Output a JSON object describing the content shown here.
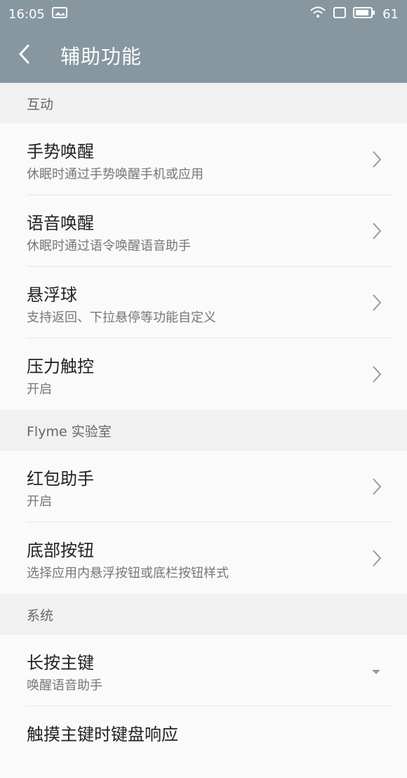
{
  "status": {
    "time": "16:05",
    "battery": "61"
  },
  "appbar": {
    "title": "辅助功能"
  },
  "sections": [
    {
      "header": "互动",
      "items": [
        {
          "title": "手势唤醒",
          "subtitle": "休眠时通过手势唤醒手机或应用"
        },
        {
          "title": "语音唤醒",
          "subtitle": "休眠时通过语令唤醒语音助手"
        },
        {
          "title": "悬浮球",
          "subtitle": "支持返回、下拉悬停等功能自定义"
        },
        {
          "title": "压力触控",
          "subtitle": "开启"
        }
      ]
    },
    {
      "header": "Flyme 实验室",
      "items": [
        {
          "title": "红包助手",
          "subtitle": "开启"
        },
        {
          "title": "底部按钮",
          "subtitle": "选择应用内悬浮按钮或底栏按钮样式"
        }
      ]
    },
    {
      "header": "系统",
      "items": [
        {
          "title": "长按主键",
          "subtitle": "唤醒语音助手"
        },
        {
          "title": "触摸主键时键盘响应",
          "subtitle": ""
        }
      ]
    }
  ],
  "colors": {
    "header_bg": "#86979f"
  }
}
